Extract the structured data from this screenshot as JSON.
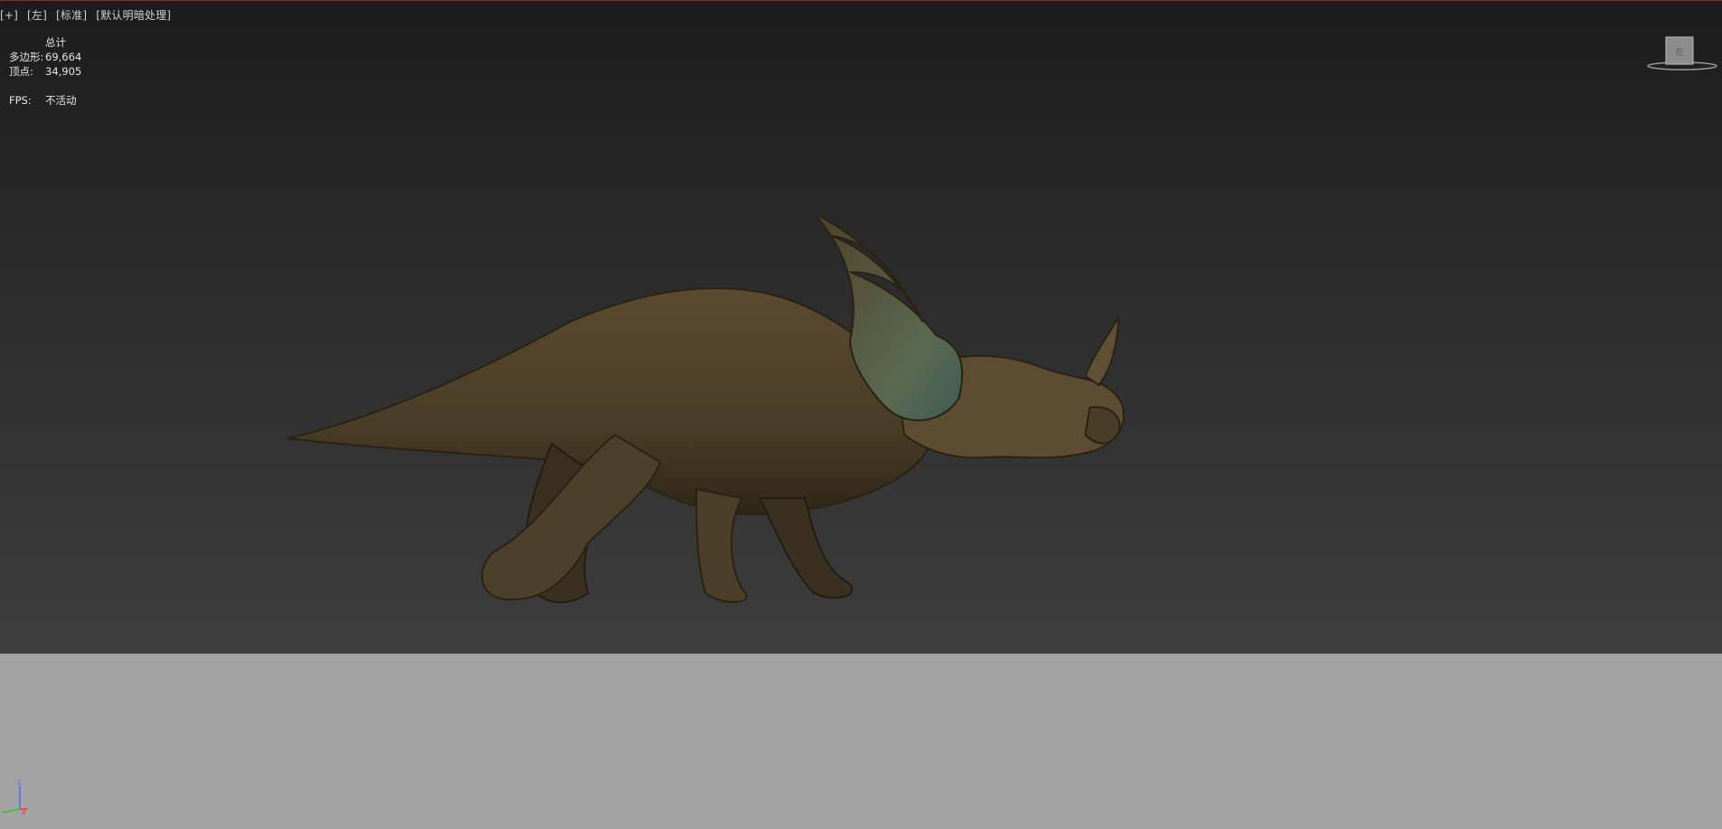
{
  "viewport": {
    "labels": [
      "[+]",
      "[左]",
      "[标准]",
      "[默认明暗处理]"
    ]
  },
  "stats": {
    "header": "总计",
    "polygons_label": "多边形:",
    "polygons_value": "69,664",
    "vertices_label": "顶点:",
    "vertices_value": "34,905",
    "fps_label": "FPS:",
    "fps_value": "不活动"
  },
  "viewcube": {
    "face_label": "左"
  },
  "axis": {
    "z_label": "z",
    "x_label": "x"
  },
  "colors": {
    "sky_top": "#1c1c1c",
    "sky_bottom": "#3d3d3d",
    "ground": "#a3a3a3",
    "axis_z": "#4a6cff",
    "axis_x": "#ff3030",
    "axis_y": "#30c030"
  }
}
